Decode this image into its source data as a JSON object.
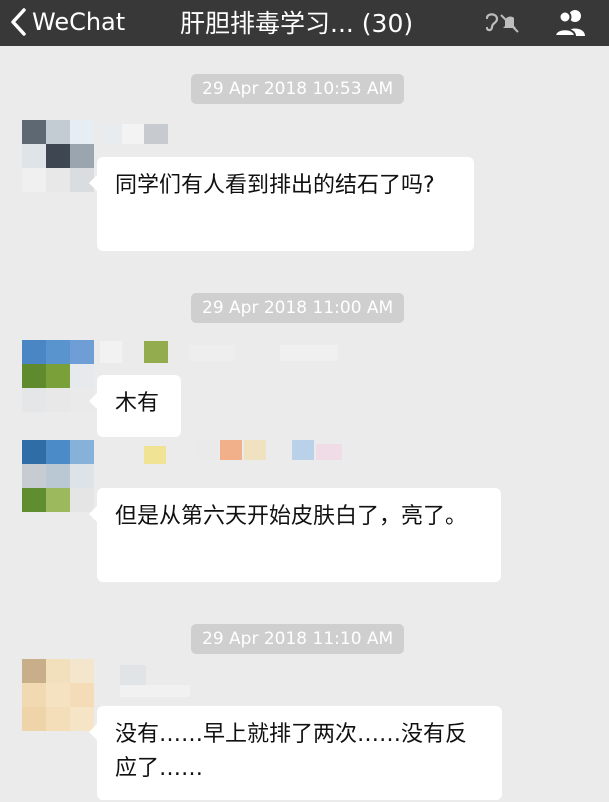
{
  "nav": {
    "back_label": "WeChat",
    "title": "肝胆排毒学习... (30)",
    "bar_color": "#383838"
  },
  "messages": [
    {
      "timestamp": "29 Apr 2018 10:53 AM",
      "text": "同学们有人看到排出的结石了吗?"
    },
    {
      "timestamp": "29 Apr 2018 11:00 AM",
      "text": "木有"
    },
    {
      "text": "但是从第六天开始皮肤白了，亮了。"
    },
    {
      "timestamp": "29 Apr 2018 11:10 AM",
      "text": "没有……早上就排了两次……没有反应了……"
    }
  ],
  "colors": {
    "background": "#ebebeb",
    "bubble": "#ffffff",
    "timestamp_pill": "#cfcfcf"
  }
}
